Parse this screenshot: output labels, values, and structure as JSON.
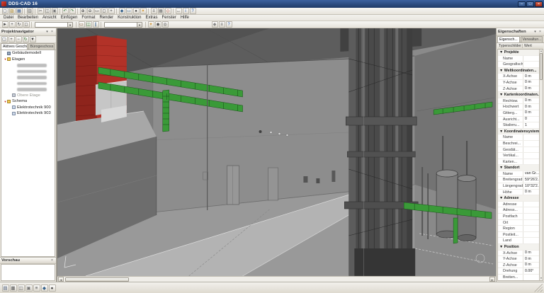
{
  "theme": {
    "titlebar": "#1f3b66",
    "chrome": "#ece9e2",
    "accent_red": "#b23228",
    "accent_red_dark": "#8e241c",
    "tray_green": "#3a9a38",
    "viewport_bg": "#8a8a8a"
  },
  "chrome_glyphs": {
    "pin": "▾",
    "close": "×",
    "group_marker": "▼",
    "tree_marker": "▼",
    "scroll_left": "◄",
    "scroll_right": "►",
    "scroll_up": "▲",
    "scroll_down": "▼"
  },
  "window": {
    "title": "DDS-CAD 16",
    "controls": [
      {
        "name": "minimize",
        "glyph": "–"
      },
      {
        "name": "maximize",
        "glyph": "□"
      },
      {
        "name": "close",
        "glyph": "×"
      }
    ]
  },
  "menubar": {
    "items": [
      "Datei",
      "Bearbeiten",
      "Ansicht",
      "Einfügen",
      "Format",
      "Render",
      "Konstruktion",
      "Extras",
      "Fenster",
      "Hilfe"
    ]
  },
  "toolbar_main": {
    "items": [
      {
        "type": "icon",
        "name": "new-file",
        "glyph": "▢",
        "color": "#4a5a78"
      },
      {
        "type": "icon",
        "name": "open-folder",
        "glyph": "▨",
        "color": "#a8842a"
      },
      {
        "type": "icon",
        "name": "save",
        "glyph": "▦",
        "color": "#3a5a8c"
      },
      {
        "type": "sep"
      },
      {
        "type": "icon",
        "name": "print",
        "glyph": "▥",
        "color": "#555555"
      },
      {
        "type": "sep"
      },
      {
        "type": "icon",
        "name": "cut",
        "glyph": "✂",
        "color": "#555555"
      },
      {
        "type": "icon",
        "name": "copy",
        "glyph": "◫",
        "color": "#555555"
      },
      {
        "type": "icon",
        "name": "paste",
        "glyph": "▣",
        "color": "#777777"
      },
      {
        "type": "sep"
      },
      {
        "type": "icon",
        "name": "undo",
        "glyph": "↶",
        "color": "#2a6a2a"
      },
      {
        "type": "icon",
        "name": "redo",
        "glyph": "↷",
        "color": "#2a6a2a"
      },
      {
        "type": "sep"
      },
      {
        "type": "icon",
        "name": "zoom-in",
        "glyph": "⊕",
        "color": "#333333"
      },
      {
        "type": "icon",
        "name": "zoom-out",
        "glyph": "⊖",
        "color": "#333333"
      },
      {
        "type": "icon",
        "name": "zoom-window",
        "glyph": "▭",
        "color": "#333333"
      },
      {
        "type": "icon",
        "name": "zoom-all",
        "glyph": "◻",
        "color": "#333333"
      },
      {
        "type": "icon",
        "name": "pan",
        "glyph": "+",
        "color": "#333333"
      },
      {
        "type": "sep"
      },
      {
        "type": "icon",
        "name": "view-3d",
        "glyph": "◆",
        "color": "#35618c"
      },
      {
        "type": "icon",
        "name": "view-plan",
        "glyph": "▭",
        "color": "#35618c"
      },
      {
        "type": "icon",
        "name": "camera",
        "glyph": "●",
        "color": "#444444"
      },
      {
        "type": "icon",
        "name": "render",
        "glyph": "☀",
        "color": "#c9820e"
      },
      {
        "type": "sep"
      },
      {
        "type": "icon",
        "name": "layers",
        "glyph": "≡",
        "color": "#444444"
      },
      {
        "type": "icon",
        "name": "grid",
        "glyph": "▦",
        "color": "#666666"
      },
      {
        "type": "icon",
        "name": "snap",
        "glyph": "◇",
        "color": "#b0341f"
      },
      {
        "type": "sep"
      },
      {
        "type": "icon",
        "name": "measure",
        "glyph": "↔",
        "color": "#444444"
      },
      {
        "type": "icon",
        "name": "info",
        "glyph": "i",
        "color": "#2255aa"
      },
      {
        "type": "icon",
        "name": "help",
        "glyph": "?",
        "color": "#2255aa"
      }
    ]
  },
  "toolbar_secondary": {
    "items": [
      {
        "type": "icon",
        "name": "select-tool",
        "glyph": "►",
        "color": "#444444"
      },
      {
        "type": "icon",
        "name": "pan-tool",
        "glyph": "+",
        "color": "#444444"
      },
      {
        "type": "icon",
        "name": "orbit-tool",
        "glyph": "↻",
        "color": "#444444"
      },
      {
        "type": "icon",
        "name": "zoom-extents",
        "glyph": "◻",
        "color": "#444444"
      },
      {
        "type": "sep"
      },
      {
        "type": "combo",
        "name": "storey-selector",
        "value": ""
      },
      {
        "type": "sep"
      },
      {
        "type": "icon",
        "name": "wall-tool",
        "glyph": "▭",
        "color": "#7a4a20"
      },
      {
        "type": "icon",
        "name": "duct-tool",
        "glyph": "◫",
        "color": "#2f7a2f"
      },
      {
        "type": "icon",
        "name": "pipe-tool",
        "glyph": "∥",
        "color": "#335e8e"
      },
      {
        "type": "sep"
      },
      {
        "type": "combo",
        "name": "system-selector",
        "value": ""
      },
      {
        "type": "sep"
      },
      {
        "type": "icon",
        "name": "light-tool",
        "glyph": "☀",
        "color": "#c9820e"
      },
      {
        "type": "icon",
        "name": "switch-tool",
        "glyph": "◉",
        "color": "#444444"
      },
      {
        "type": "icon",
        "name": "socket-tool",
        "glyph": "◎",
        "color": "#444444"
      },
      {
        "type": "gap"
      },
      {
        "type": "icon",
        "name": "sun-study",
        "glyph": "◆",
        "color": "#888888"
      },
      {
        "type": "icon",
        "name": "view-settings",
        "glyph": "≡",
        "color": "#444444"
      },
      {
        "type": "icon",
        "name": "context-help",
        "glyph": "?",
        "color": "#2255aa"
      }
    ]
  },
  "project_navigator": {
    "title": "Projektnavigator",
    "toolbar": [
      {
        "type": "icon",
        "name": "new-item",
        "glyph": "▢",
        "color": "#4a5a78"
      },
      {
        "type": "icon",
        "name": "expand-all",
        "glyph": "+",
        "color": "#444444"
      },
      {
        "type": "icon",
        "name": "collapse-all",
        "glyph": "−",
        "color": "#444444"
      },
      {
        "type": "icon",
        "name": "refresh",
        "glyph": "↻",
        "color": "#2a6a2a"
      },
      {
        "type": "icon",
        "name": "filter",
        "glyph": "▼",
        "color": "#444444"
      }
    ],
    "tabs": [
      {
        "label": "Aktives Geschoss",
        "active": true
      },
      {
        "label": "Bürogeschoss (B)",
        "active": false
      }
    ],
    "tree": [
      {
        "label": "Gebäudemodell",
        "level": 0,
        "icon": "building"
      },
      {
        "label": "Etagen",
        "level": 0,
        "icon": "folder",
        "marker": true
      },
      {
        "redacted": true,
        "level": 1
      },
      {
        "redacted": true,
        "level": 1
      },
      {
        "redacted": true,
        "level": 1
      },
      {
        "redacted": true,
        "level": 1
      },
      {
        "redacted": true,
        "level": 1
      },
      {
        "label": "Obere Etage",
        "level": 1,
        "icon": "floor",
        "muted": true
      },
      {
        "label": "Schema",
        "level": 0,
        "icon": "folder",
        "marker": true
      },
      {
        "label": "Elektrotechnik 900",
        "level": 1,
        "icon": "sheet"
      },
      {
        "label": "Elektrotechnik 903",
        "level": 1,
        "icon": "sheet"
      }
    ],
    "bottom_panel_title": "Vorschau"
  },
  "properties_panel": {
    "title": "Eigenschaften",
    "tabs": [
      {
        "label": "Eigensch...",
        "active": true
      },
      {
        "label": "Verwaltun...",
        "active": false
      }
    ],
    "columns": [
      "Typenschilder",
      "Wert"
    ],
    "rows": [
      {
        "label": "Projekte",
        "group": true
      },
      {
        "label": "Name",
        "value": ""
      },
      {
        "label": "Geografisch...",
        "value": ""
      },
      {
        "label": "Weltkoordinaten...",
        "group": true
      },
      {
        "label": "X-Achse",
        "value": "0 m"
      },
      {
        "label": "Y-Achse",
        "value": "0 m"
      },
      {
        "label": "Z-Achse",
        "value": "0 m"
      },
      {
        "label": "Kartenkoordinaten...",
        "group": true
      },
      {
        "label": "Rechtsw.",
        "value": "0 m"
      },
      {
        "label": "Hochwert",
        "value": "0 m"
      },
      {
        "label": "Gitterg...",
        "value": "0 m"
      },
      {
        "label": "Ausricht...",
        "value": "0"
      },
      {
        "label": "Skalieru...",
        "value": "1"
      },
      {
        "label": "Koordinatensystem...",
        "group": true
      },
      {
        "label": "Name",
        "value": ""
      },
      {
        "label": "Beschrei...",
        "value": ""
      },
      {
        "label": "Geodät...",
        "value": ""
      },
      {
        "label": "Vertikal...",
        "value": ""
      },
      {
        "label": "Karten...",
        "value": ""
      },
      {
        "label": "Standort",
        "group": true
      },
      {
        "label": "Name",
        "value": "van Gr..."
      },
      {
        "label": "Breitengrad",
        "value": "59°26'2..."
      },
      {
        "label": "Längengrad",
        "value": "10°32'2..."
      },
      {
        "label": "Höhe",
        "value": "0 m"
      },
      {
        "label": "Adresse",
        "group": true
      },
      {
        "label": "Adresse",
        "value": ""
      },
      {
        "label": "Adress...",
        "value": ""
      },
      {
        "label": "Postfach",
        "value": ""
      },
      {
        "label": "Ort",
        "value": ""
      },
      {
        "label": "Region",
        "value": ""
      },
      {
        "label": "Postleit...",
        "value": ""
      },
      {
        "label": "Land",
        "value": ""
      },
      {
        "label": "Position",
        "group": true
      },
      {
        "label": "X-Achse",
        "value": "0 m"
      },
      {
        "label": "Y-Achse",
        "value": "0 m"
      },
      {
        "label": "Z-Achse",
        "value": "0 m"
      },
      {
        "label": "Drehung",
        "value": "0.00°"
      },
      {
        "label": "Breiten...",
        "value": ""
      }
    ]
  },
  "statusbar": {
    "icons": [
      {
        "type": "icon",
        "name": "dock-project",
        "glyph": "▤",
        "color": "#4a5a78"
      },
      {
        "type": "icon",
        "name": "dock-model",
        "glyph": "▦",
        "color": "#555555"
      },
      {
        "type": "icon",
        "name": "dock-components",
        "glyph": "◫",
        "color": "#555555"
      },
      {
        "type": "icon",
        "name": "dock-database",
        "glyph": "▣",
        "color": "#777777"
      },
      {
        "type": "icon",
        "name": "dock-layers",
        "glyph": "≡",
        "color": "#444444"
      },
      {
        "type": "icon",
        "name": "dock-list",
        "glyph": "◆",
        "color": "#35618c"
      },
      {
        "type": "icon",
        "name": "dock-settings",
        "glyph": "●",
        "color": "#444444"
      }
    ]
  },
  "viewport": {
    "scene": "3d-building-interior-with-cable-trays-and-risers"
  }
}
